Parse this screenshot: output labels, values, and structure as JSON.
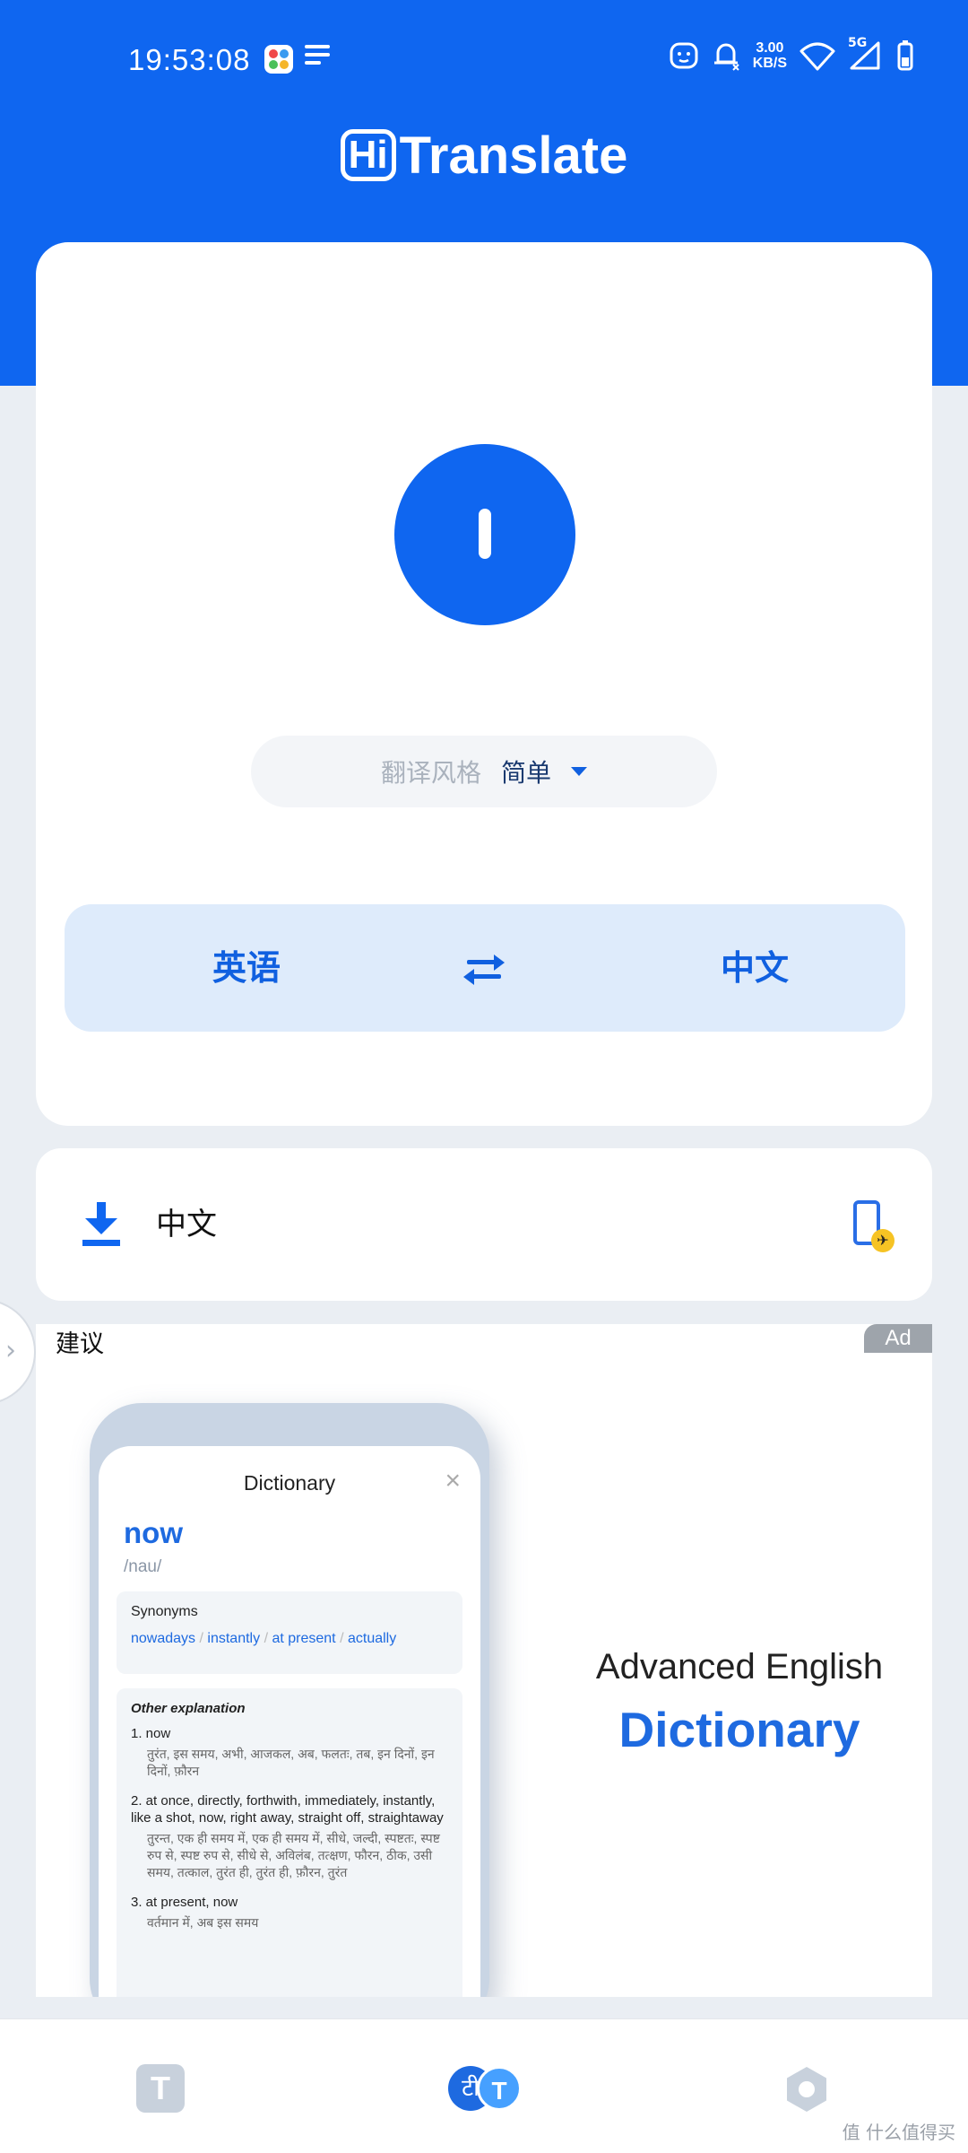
{
  "status_bar": {
    "time": "19:53:08",
    "net_speed_value": "3.00",
    "net_speed_unit": "KB/S",
    "signal_label": "5G"
  },
  "app": {
    "title_badge": "Hi",
    "title_text": "Translate"
  },
  "translate": {
    "style_label": "翻译风格",
    "style_value": "简单",
    "source_language": "英语",
    "target_language": "中文"
  },
  "offline": {
    "language_label": "中文"
  },
  "ad": {
    "section_label": "建议",
    "badge": "Ad",
    "headline_line1": "Advanced English",
    "headline_line2": "Dictionary",
    "mock": {
      "title": "Dictionary",
      "close": "×",
      "word": "now",
      "phonetic": "/nau/",
      "synonyms_heading": "Synonyms",
      "synonyms": [
        "nowadays",
        "instantly",
        "at present",
        "actually"
      ],
      "explanation_heading": "Other explanation",
      "items": [
        {
          "text": "1. now",
          "sub": "तुरंत, इस समय, अभी, आजकल, अब, फलतः, तब, इन दिनों, इन दिनों, फ़ौरन"
        },
        {
          "text": "2. at once, directly, forthwith, immediately, instantly, like a shot, now, right away, straight off, straightaway",
          "sub": "तुरन्त, एक ही समय में, एक ही समय में, सीधे, जल्दी, स्पष्टतः, स्पष्ट रुप से, स्पष्ट रुप से, सीधे से, अविलंब, तत्क्षण, फौरन, ठीक, उसी समय, तत्काल, तुरंत ही, तुरंत ही, फ़ौरन, तुरंत"
        },
        {
          "text": "3. at present, now",
          "sub": "वर्तमान में, अब इस समय"
        }
      ]
    }
  },
  "bottom_nav": {
    "text_tab_glyph": "T",
    "conversation_glyph_left": "टी",
    "conversation_glyph_right": "T"
  },
  "watermark": "值 什么值得买",
  "colors": {
    "brand_blue": "#0f66f0",
    "light_blue": "#deebfb",
    "page_bg": "#eaeef3"
  }
}
